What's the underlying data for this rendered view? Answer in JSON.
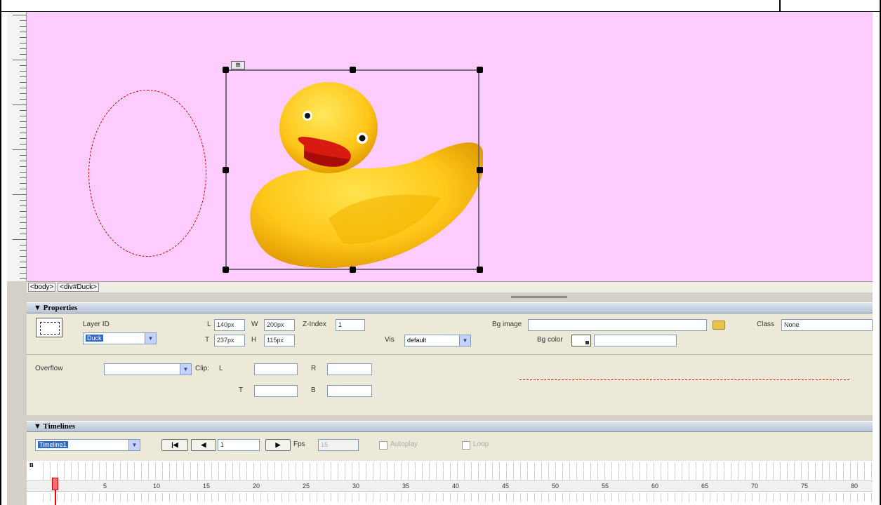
{
  "tag_selector": {
    "tags": [
      "<body>",
      "<div#Duck>"
    ]
  },
  "properties": {
    "title": "Properties",
    "layer_id_label": "Layer ID",
    "layer_id_value": "Duck",
    "l_label": "L",
    "l_value": "140px",
    "t_label": "T",
    "t_value": "237px",
    "w_label": "W",
    "w_value": "200px",
    "h_label": "H",
    "h_value": "115px",
    "zindex_label": "Z-Index",
    "zindex_value": "1",
    "vis_label": "Vis",
    "vis_value": "default",
    "bg_image_label": "Bg image",
    "bg_image_value": "",
    "bg_color_label": "Bg color",
    "bg_color_value": "",
    "class_label": "Class",
    "class_value": "None",
    "overflow_label": "Overflow",
    "overflow_value": "",
    "clip_label": "Clip:",
    "clip_l_label": "L",
    "clip_r_label": "R",
    "clip_t_label": "T",
    "clip_b_label": "B"
  },
  "timelines": {
    "title": "Timelines",
    "timeline_name": "Timeline1",
    "frame_value": "1",
    "fps_label": "Fps",
    "fps_value": "15",
    "autoplay_label": "Autoplay",
    "loop_label": "Loop",
    "frame_numbers": [
      "1",
      "5",
      "10",
      "15",
      "20",
      "25",
      "30",
      "35",
      "40",
      "45",
      "50",
      "55",
      "60",
      "65",
      "70",
      "75",
      "80"
    ],
    "row_label_b": "B"
  },
  "colors": {
    "canvas_bg": "#ffccff",
    "annotation": "#d40000",
    "selection": "#316ac5"
  }
}
